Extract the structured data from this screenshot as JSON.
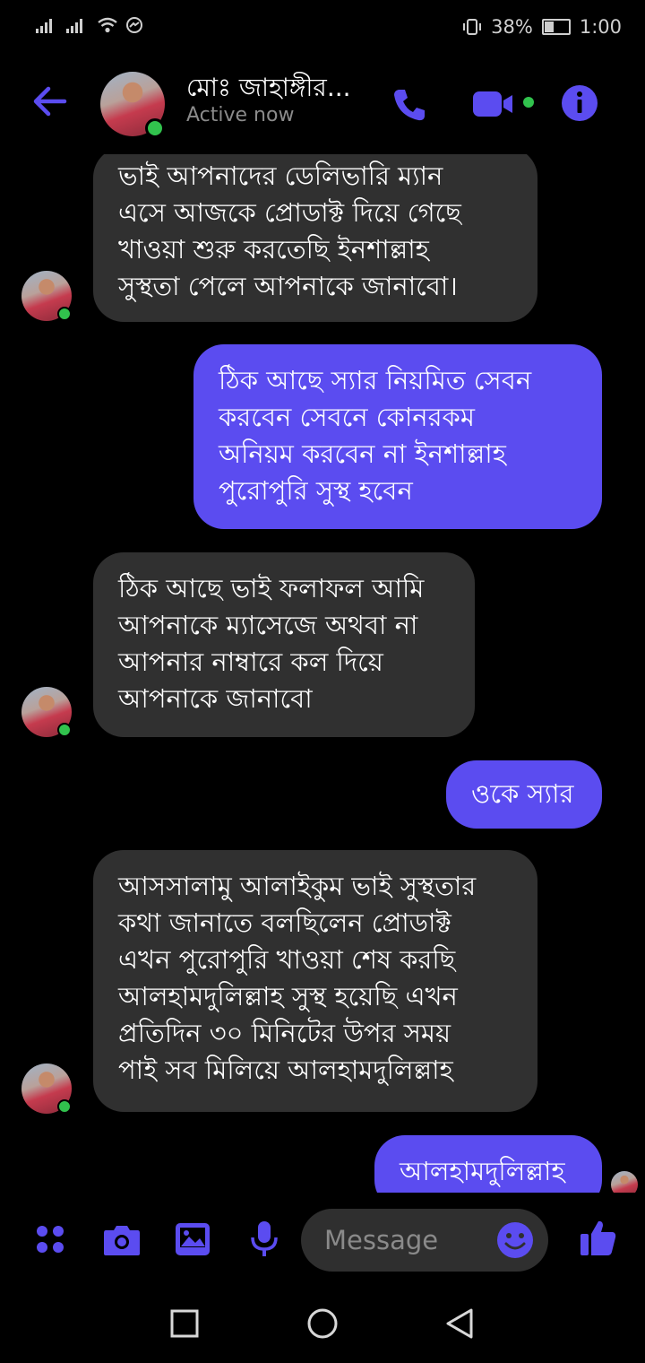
{
  "status_bar": {
    "battery_percent": "38%",
    "time": "1:00"
  },
  "header": {
    "contact_name": "মোঃ জাহাঙ্গীর...",
    "presence": "Active now",
    "accent_color": "#5b4cf0",
    "icons": [
      "back-arrow-icon",
      "phone-icon",
      "video-camera-icon",
      "info-icon"
    ]
  },
  "messages": [
    {
      "direction": "incoming",
      "lines": [
        "ভাই আপনাদের ডেলিভারি ম্যান",
        "এসে আজকে প্রোডাক্ট দিয়ে গেছে",
        "খাওয়া শুরু করতেছি ইনশাল্লাহ",
        "সুস্থতা পেলে আপনাকে জানাবো।"
      ]
    },
    {
      "direction": "outgoing",
      "lines": [
        "ঠিক আছে স্যার নিয়মিত সেবন",
        "করবেন সেবনে কোনরকম",
        "অনিয়ম করবেন না ইনশাল্লাহ",
        "পুরোপুরি সুস্থ হবেন"
      ]
    },
    {
      "direction": "incoming",
      "lines": [
        "ঠিক আছে ভাই ফলাফল আমি",
        "আপনাকে ম্যাসেজে অথবা না",
        "আপনার নাম্বারে কল দিয়ে",
        "আপনাকে জানাবো"
      ]
    },
    {
      "direction": "outgoing",
      "lines": [
        "ওকে স্যার"
      ]
    },
    {
      "direction": "incoming",
      "lines": [
        "আসসালামু আলাইকুম ভাই সুস্থতার",
        "কথা জানাতে বলছিলেন প্রোডাক্ট",
        "এখন পুরোপুরি খাওয়া শেষ করছি",
        "আলহামদুলিল্লাহ সুস্থ হয়েছি এখন",
        "প্রতিদিন ৩০ মিনিটের উপর সময়",
        "পাই সব মিলিয়ে আলহামদুলিল্লাহ"
      ]
    },
    {
      "direction": "outgoing",
      "lines": [
        "আলহামদুলিল্লাহ"
      ]
    }
  ],
  "composer": {
    "placeholder": "Message",
    "icons": [
      "apps-icon",
      "camera-icon",
      "gallery-icon",
      "microphone-icon",
      "emoji-icon",
      "thumbs-up-icon"
    ]
  },
  "nav_bar": {
    "icons": [
      "recent-apps-icon",
      "home-icon",
      "back-icon"
    ]
  }
}
